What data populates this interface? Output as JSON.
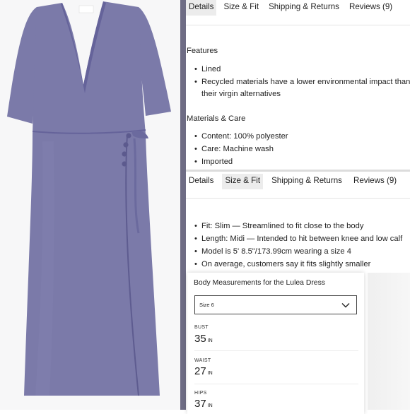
{
  "colors": {
    "dress": "#7b7aa9",
    "dress_shadow": "#65639a",
    "divider": "#6e6c84",
    "tab_active_bg": "#ececec"
  },
  "top_section": {
    "tabs": [
      {
        "label": "Details",
        "active": true
      },
      {
        "label": "Size & Fit",
        "active": false
      },
      {
        "label": "Shipping & Returns",
        "active": false
      },
      {
        "label": "Reviews (9)",
        "active": false
      }
    ],
    "features_heading": "Features",
    "features": [
      "Lined",
      "Recycled materials have a lower environmental impact than",
      "their virgin alternatives"
    ],
    "materials_heading": "Materials & Care",
    "materials": [
      "Content: 100% polyester",
      "Care: Machine wash",
      "Imported"
    ]
  },
  "bottom_section": {
    "tabs": [
      {
        "label": "Details",
        "active": false
      },
      {
        "label": "Size & Fit",
        "active": true
      },
      {
        "label": "Shipping & Returns",
        "active": false
      },
      {
        "label": "Reviews (9)",
        "active": false
      }
    ],
    "fit_items": [
      "Fit: Slim — Streamlined to fit close to the body",
      "Length: Midi — Intended to hit between knee and low calf",
      "Model is 5' 8.5\"/173.99cm wearing a size 4",
      "On average, customers say it fits slightly smaller"
    ]
  },
  "measurements": {
    "title": "Body Measurements for the Lulea Dress",
    "selected_size": "Size 6",
    "chevron_icon": "chevron-down-icon",
    "rows": [
      {
        "label": "BUST",
        "value": "35",
        "unit": "IN"
      },
      {
        "label": "WAIST",
        "value": "27",
        "unit": "IN"
      },
      {
        "label": "HIPS",
        "value": "37",
        "unit": "IN"
      }
    ]
  }
}
